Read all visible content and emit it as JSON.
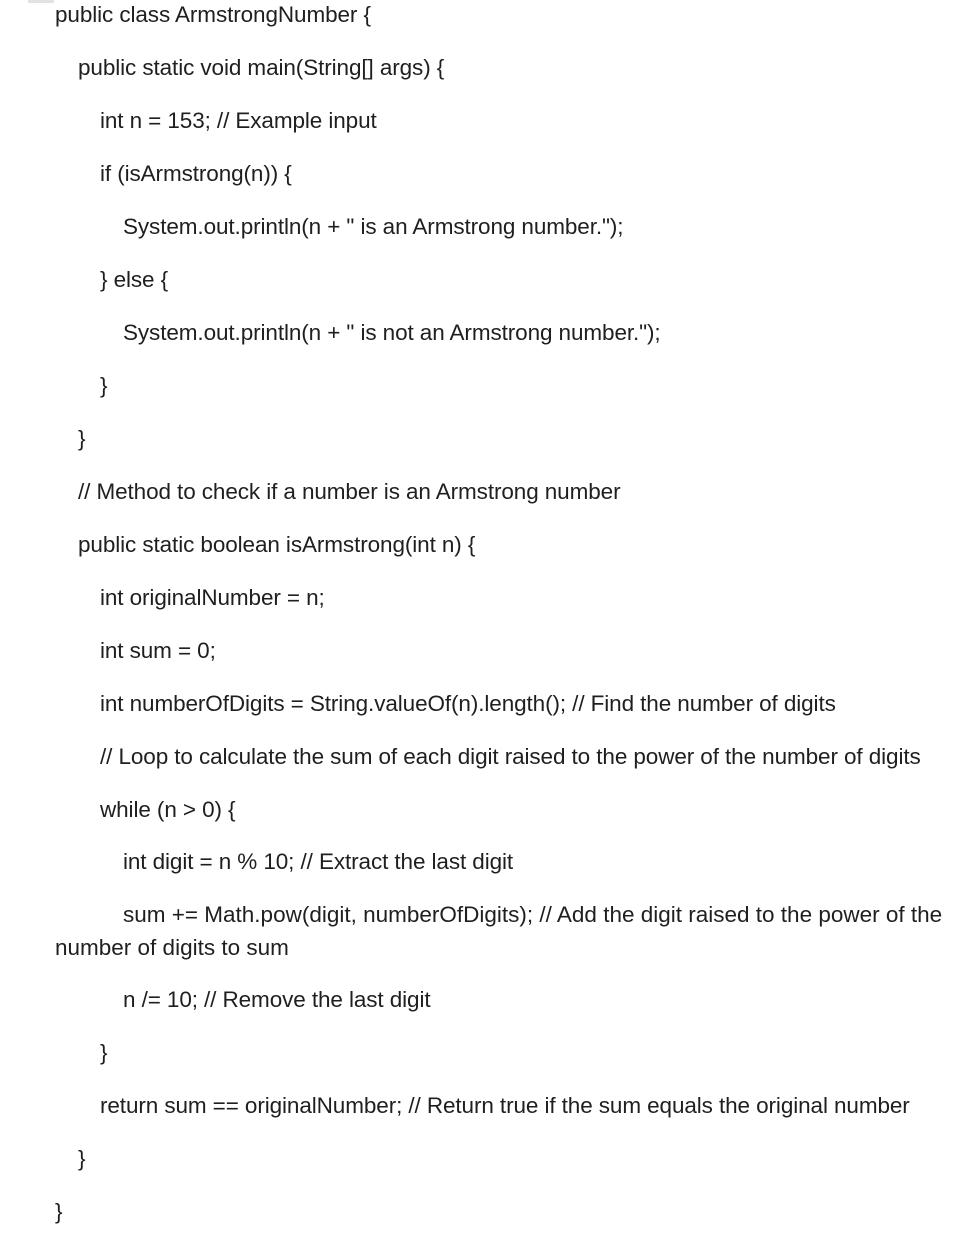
{
  "code": {
    "lines": [
      "public class ArmstrongNumber {",
      "public static void main(String[] args) {",
      "int n = 153; // Example input",
      "if (isArmstrong(n)) {",
      "System.out.println(n + \" is an Armstrong number.\");",
      "} else {",
      "System.out.println(n + \" is not an Armstrong number.\");",
      "}",
      "}",
      "// Method to check if a number is an Armstrong number",
      "public static boolean isArmstrong(int n) {",
      "int originalNumber = n;",
      "int sum = 0;",
      "int numberOfDigits = String.valueOf(n).length(); // Find the number of digits",
      "// Loop to calculate the sum of each digit raised to the power of the number of digits",
      "while (n > 0) {",
      "int digit = n % 10; // Extract the last digit",
      "sum += Math.pow(digit, numberOfDigits); // Add the digit raised to the power of the",
      "number of digits to sum",
      "n /= 10; // Remove the last digit",
      "}",
      "return sum == originalNumber; // Return true if the sum equals the original number",
      "}",
      "}"
    ]
  }
}
